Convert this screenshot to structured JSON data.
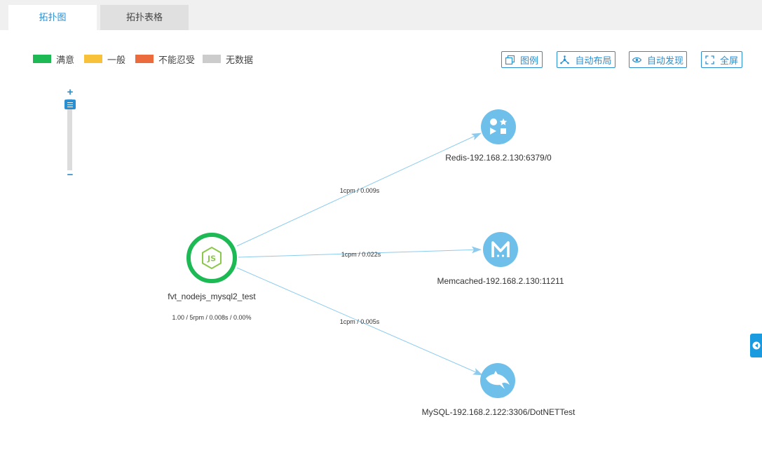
{
  "tabs": [
    {
      "label": "拓扑图",
      "active": true
    },
    {
      "label": "拓扑表格",
      "active": false
    }
  ],
  "legend": [
    {
      "label": "满意",
      "color": "#1db954"
    },
    {
      "label": "一般",
      "color": "#f7c23a"
    },
    {
      "label": "不能忍受",
      "color": "#ec6b3c"
    },
    {
      "label": "无数据",
      "color": "#cccccc"
    }
  ],
  "toolbar": {
    "legend_label": "图例",
    "auto_layout_label": "自动布局",
    "auto_discover_label": "自动发现",
    "fullscreen_label": "全屏"
  },
  "zoom": {
    "plus": "+",
    "minus": "−"
  },
  "topology": {
    "app": {
      "name": "fvt_nodejs_mysql2_test",
      "stats": "1.00 / 5rpm / 0.008s / 0.00%",
      "icon": "nodejs-icon",
      "status_color": "#1db954"
    },
    "services": [
      {
        "name": "Redis-192.168.2.130:6379/0",
        "icon": "redis-shapes-icon",
        "edge_label": "1cpm / 0.009s"
      },
      {
        "name": "Memcached-192.168.2.130:11211",
        "icon": "memcached-icon",
        "edge_label": "1cpm / 0.022s"
      },
      {
        "name": "MySQL-192.168.2.122:3306/DotNETTest",
        "icon": "mysql-dolphin-icon",
        "edge_label": "1cpm / 0.005s"
      }
    ],
    "service_color": "#6ec0ea",
    "edge_color": "#8ccbee"
  }
}
